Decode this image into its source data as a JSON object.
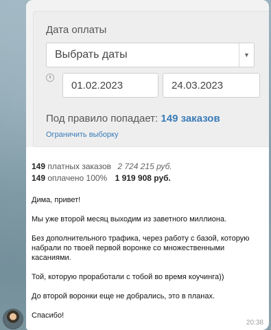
{
  "filter": {
    "section_label": "Дата оплаты",
    "select_placeholder": "Выбрать даты",
    "date_from": "01.02.2023",
    "date_to": "24.03.2023",
    "rule_prefix": "Под правило попадает:",
    "rule_count": "149 заказов",
    "limit_link": "Ограничить выборку"
  },
  "stats": {
    "row1_count": "149",
    "row1_label": "платных заказов",
    "row1_amount": "2 724 215 руб.",
    "row2_count": "149",
    "row2_label": "оплачено 100%",
    "row2_amount": "1 919 908 руб."
  },
  "message": {
    "paragraphs": [
      "Дима, привет!",
      "Мы уже второй месяц выходим из заветного миллиона.",
      "Без дополнительного трафика, через работу с базой, которую набрали по твоей первой воронке со множественными касаниями.",
      "Той, которую проработали с тобой во время коучинга))",
      "До второй воронки еще не добрались, это в планах.",
      "Спасибо!"
    ],
    "time": "20:38"
  }
}
